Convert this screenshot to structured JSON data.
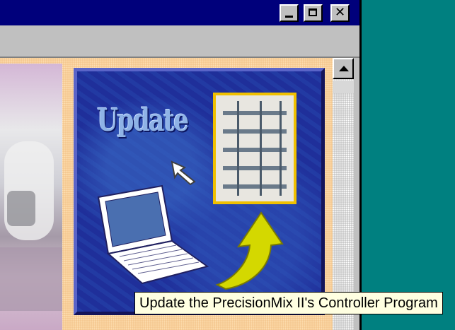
{
  "window": {
    "titlebar_color": "#00007b",
    "buttons": {
      "minimize": {
        "icon": "minimize-icon"
      },
      "maximize": {
        "icon": "maximize-icon"
      },
      "close": {
        "icon": "close-icon",
        "label": "✕"
      }
    }
  },
  "panel": {
    "title": "Update",
    "icons": [
      "control-cabinet-image",
      "pointer-arrow-icon",
      "laptop-icon",
      "curved-arrow-icon"
    ],
    "colors": {
      "background": "#1f2f9a",
      "arrow": "#d4d800",
      "cabinet_frame": "#f0c000"
    }
  },
  "tooltip": {
    "text": "Update the PrecisionMix II's Controller Program"
  },
  "scrollbar": {
    "up_icon": "scroll-up-arrow-icon"
  },
  "desktop": {
    "color": "#008080"
  }
}
